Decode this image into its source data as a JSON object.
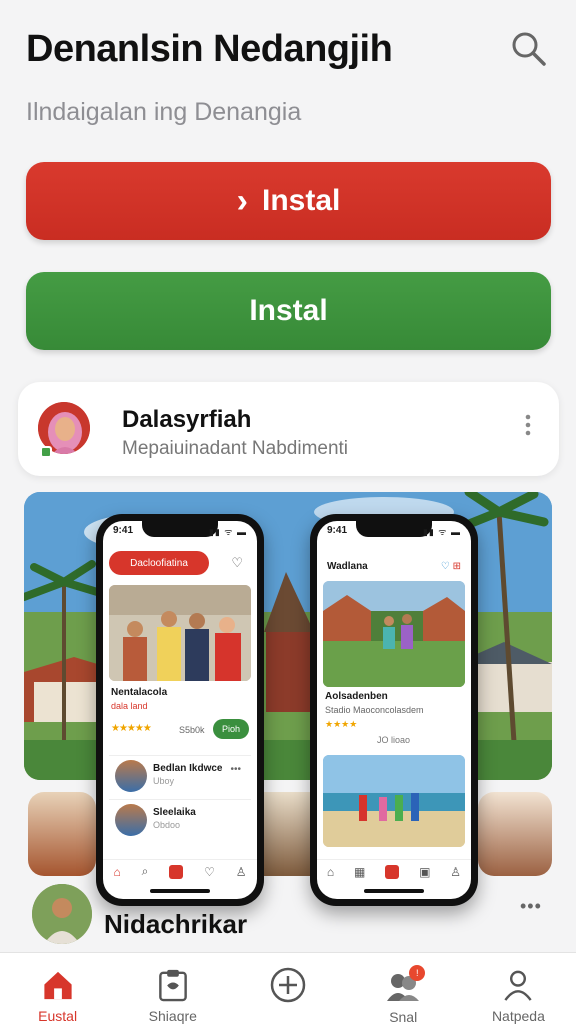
{
  "header": {
    "title": "Denanlsin Nedangjih",
    "subtitle": "Ilndaigalan ing Denangia"
  },
  "buttons": {
    "primary_label": "Instal",
    "primary_chevron": "›",
    "secondary_label": "Instal"
  },
  "profile": {
    "name": "Dalasyrfiah",
    "subtitle": "Mepaiuinadant Nabdimenti"
  },
  "phone_left": {
    "time": "9:41",
    "status": "▮▮ ᯤ ▬",
    "pill_label": "Dacloofiatina",
    "item_title": "Nentalacola",
    "item_sub": "dala land",
    "stars": "★★★★★",
    "price": "S5b0k",
    "action": "Pioh",
    "rows": [
      {
        "title": "Bedlan Ikdwce",
        "sub": "Uboy"
      },
      {
        "title": "Sleelaika",
        "sub": "Obdoo"
      }
    ]
  },
  "phone_right": {
    "time": "9:41",
    "status": "▮▮ ᯤ ▬",
    "title": "Wadlana",
    "card_title": "Aolsadenben",
    "card_sub": "Stadio Maoconcolasdem",
    "stars": "★★★★",
    "meta": "JO lioao"
  },
  "post": {
    "name": "Nidachrikar",
    "more": "•••"
  },
  "tabbar": {
    "items": [
      {
        "label": "Eustal",
        "icon": "home-icon",
        "active": true
      },
      {
        "label": "Shiaqre",
        "icon": "clipboard-icon",
        "active": false
      },
      {
        "label": "",
        "icon": "add-icon",
        "active": false
      },
      {
        "label": "Snal",
        "icon": "community-icon",
        "active": false,
        "badge": "!"
      },
      {
        "label": "Natpeda",
        "icon": "person-icon",
        "active": false
      }
    ]
  },
  "colors": {
    "accent_red": "#d7362b",
    "accent_green": "#3f943f"
  }
}
